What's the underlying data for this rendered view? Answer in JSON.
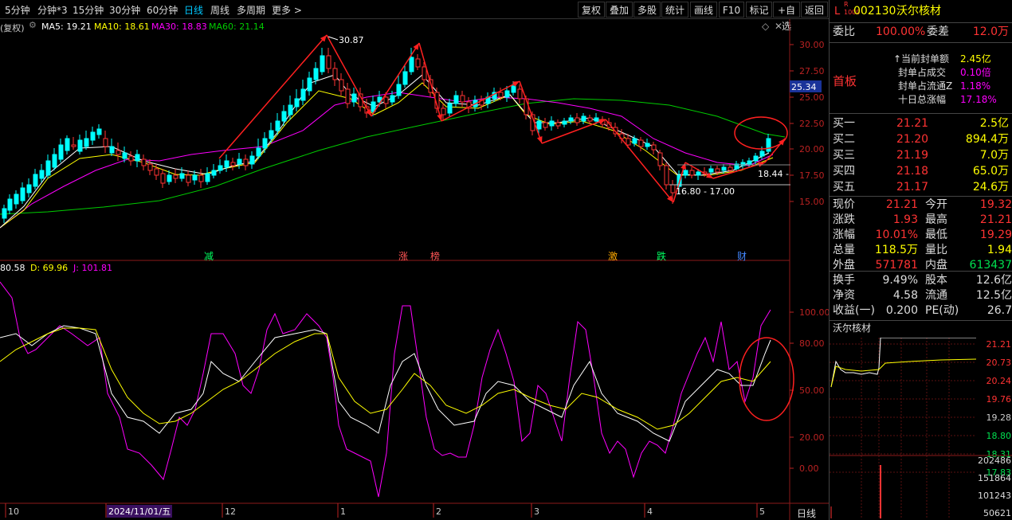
{
  "toolbar": {
    "periods": [
      "5分钟",
      "分钟*3",
      "15分钟",
      "30分钟",
      "60分钟",
      "日线",
      "周线",
      "多周期",
      "更多 >"
    ],
    "selected": "日线",
    "buttons": [
      "复权",
      "叠加",
      "多股",
      "统计",
      "画线",
      "F10",
      "标记",
      "+自选",
      "返回"
    ]
  },
  "ma": {
    "prefix": "(复权)",
    "ma5": "MA5: 19.21",
    "ma10": "MA10: 18.61",
    "ma30": "MA30: 18.83",
    "ma60": "MA60: 21.14",
    "colors": {
      "ma5": "#ffffff",
      "ma10": "#ffff00",
      "ma30": "#ff00ff",
      "ma60": "#00cc00"
    }
  },
  "price_axis": [
    "30.00",
    "27.50",
    "25.00",
    "22.50",
    "20.00",
    "17.50",
    "15.00"
  ],
  "price_marker": "25.34",
  "annotations": {
    "high": "30.87",
    "low": "16.80 - 17.00",
    "support": "18.44 -"
  },
  "events": [
    "减",
    "涨",
    "榜",
    "激",
    "跌",
    "财"
  ],
  "kdj": {
    "k": "80.58",
    "d": "D: 69.96",
    "j": "J: 101.81"
  },
  "kdj_axis": [
    "100.00",
    "80.00",
    "50.00",
    "20.00",
    "0.00"
  ],
  "date_axis": [
    "10",
    "2024/11/01/五",
    "12",
    "1",
    "2",
    "3",
    "4",
    "5"
  ],
  "period_label": "日线",
  "stock": {
    "prefix": "L",
    "code": "002130",
    "name": "沃尔核材"
  },
  "weibi": {
    "label": "委比",
    "value": "100.00%",
    "label2": "委差",
    "value2": "12.0万"
  },
  "board": {
    "title": "首板",
    "lines": [
      [
        "当前封单额",
        "2.45亿"
      ],
      [
        "封单占成交",
        "0.10倍"
      ],
      [
        "封单占流通Z",
        "1.18%"
      ],
      [
        "十日总涨幅",
        "17.18%"
      ]
    ]
  },
  "bids": [
    [
      "买一",
      "21.21",
      "2.5亿"
    ],
    [
      "买二",
      "21.20",
      "894.4万"
    ],
    [
      "买三",
      "21.19",
      "7.0万"
    ],
    [
      "买四",
      "21.18",
      "65.0万"
    ],
    [
      "买五",
      "21.17",
      "24.6万"
    ]
  ],
  "quote": [
    [
      "现价",
      "21.21",
      "今开",
      "19.32"
    ],
    [
      "涨跌",
      "1.93",
      "最高",
      "21.21"
    ],
    [
      "涨幅",
      "10.01%",
      "最低",
      "19.29"
    ],
    [
      "总量",
      "118.5万",
      "量比",
      "1.94"
    ],
    [
      "外盘",
      "571781",
      "内盘",
      "613437"
    ]
  ],
  "stats": [
    [
      "换手",
      "9.49%",
      "股本",
      "12.6亿"
    ],
    [
      "净资",
      "4.58",
      "流通",
      "12.5亿"
    ],
    [
      "收益(一)",
      "0.200",
      "PE(动)",
      "26.7"
    ]
  ],
  "mini": {
    "title": "沃尔核材",
    "prices": [
      "21.21",
      "20.73",
      "20.24",
      "19.76",
      "19.28",
      "18.80",
      "18.31",
      "17.83"
    ],
    "vols": [
      "202486",
      "151864",
      "101243",
      "50621"
    ]
  }
}
